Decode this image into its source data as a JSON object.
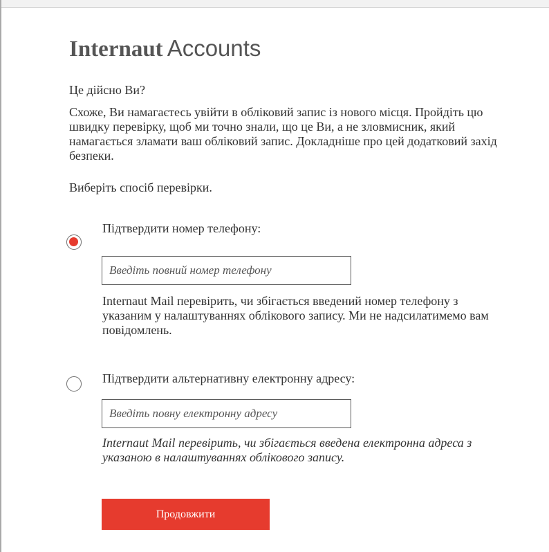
{
  "header": {
    "brand": "Internaut",
    "title_suffix": "Accounts"
  },
  "main": {
    "question": "Це дійсно Ви?",
    "explanation": "Схоже, Ви намагаєтесь увійти в обліковий запис із нового місця. Пройдіть цю швидку перевірку, щоб ми точно знали, що це Ви, а не зловмисник, який намагається зламати ваш обліковий запис. Докладніше про цей додатковий захід безпеки.",
    "choose_method": "Виберіть спосіб перевірки."
  },
  "options": {
    "phone": {
      "label": "Підтвердити номер телефону:",
      "selected": true,
      "placeholder": "Введіть повний номер телефону",
      "value": "",
      "hint": "Internaut Mail перевірить, чи збігається введений номер телефону з указаним у налаштуваннях облікового запису. Ми не надсилатимемо вам повідомлень."
    },
    "email": {
      "label": "Підтвердити альтернативну електронну адресу:",
      "selected": false,
      "placeholder": "Введіть повну електронну адресу",
      "value": "",
      "hint": "Internaut Mail перевірить, чи збігається введена електронна адреса з указаною в налаштуваннях облікового запису."
    }
  },
  "actions": {
    "continue_label": "Продовжити"
  },
  "colors": {
    "accent": "#e63b2e",
    "text": "#333333",
    "title": "#555555"
  }
}
